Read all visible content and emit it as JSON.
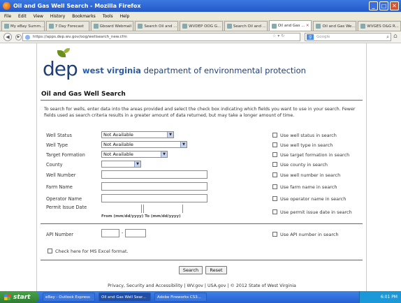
{
  "window": {
    "title": "Oil and Gas Well Search - Mozilla Firefox"
  },
  "menu": [
    "File",
    "Edit",
    "View",
    "History",
    "Bookmarks",
    "Tools",
    "Help"
  ],
  "tabs": [
    {
      "label": "My eBay Summ..."
    },
    {
      "label": "7 Day Forecast"
    },
    {
      "label": "Gboard Webmail"
    },
    {
      "label": "Search Oil and ..."
    },
    {
      "label": "WVDEP OOG G..."
    },
    {
      "label": "Search Oil and ..."
    },
    {
      "label": "Oil and Gas ..."
    },
    {
      "label": "Oil and Gas We..."
    },
    {
      "label": "WVGES O&G R..."
    }
  ],
  "nav": {
    "url": "https://apps.dep.wv.gov/oog/wellsearch_new.cfm",
    "search_placeholder": "Google"
  },
  "site": {
    "logo": "dep",
    "org_bold": "west virginia",
    "org_rest": " department of environmental protection"
  },
  "page": {
    "title": "Oil and Gas Well Search",
    "intro": "To search for wells, enter data into the areas provided and select the check box indicating which fields you want to use in your search. Fewer fields used as search criteria results in a greater amount of data returned, but may take a longer amount of time."
  },
  "fields": {
    "well_status": {
      "label": "Well Status",
      "value": "Not Available",
      "use": "Use well status in search"
    },
    "well_type": {
      "label": "Well Type",
      "value": "Not Available",
      "use": "Use well type in search"
    },
    "target_formation": {
      "label": "Target Formation",
      "value": "Not Available",
      "use": "Use target formation in search"
    },
    "county": {
      "label": "County",
      "value": "",
      "use": "Use county in search"
    },
    "well_number": {
      "label": "Well Number",
      "use": "Use well number in search"
    },
    "farm_name": {
      "label": "Farm Name",
      "use": "Use farm name in search"
    },
    "operator_name": {
      "label": "Operator Name",
      "use": "Use operator name in search"
    },
    "permit_date": {
      "label": "Permit Issue Date",
      "hint": "From (mm/dd/yyyy)  To (mm/dd/yyyy)",
      "use": "Use permit issue date in search"
    },
    "api_number": {
      "label": "API Number",
      "sep": "-",
      "use": "Use API number in search"
    }
  },
  "excel": {
    "label": "Check here for MS Excel format."
  },
  "buttons": {
    "search": "Search",
    "reset": "Reset"
  },
  "footer": {
    "text": "Privacy, Security and Accessibility | WV.gov | USA.gov | © 2012 State of West Virginia"
  },
  "taskbar": {
    "start": "start",
    "items": [
      "eBay - Outlook Express",
      "Oil and Gas Well Sear...",
      "Adobe Fireworks CS3..."
    ],
    "time": "6:01 PM"
  }
}
